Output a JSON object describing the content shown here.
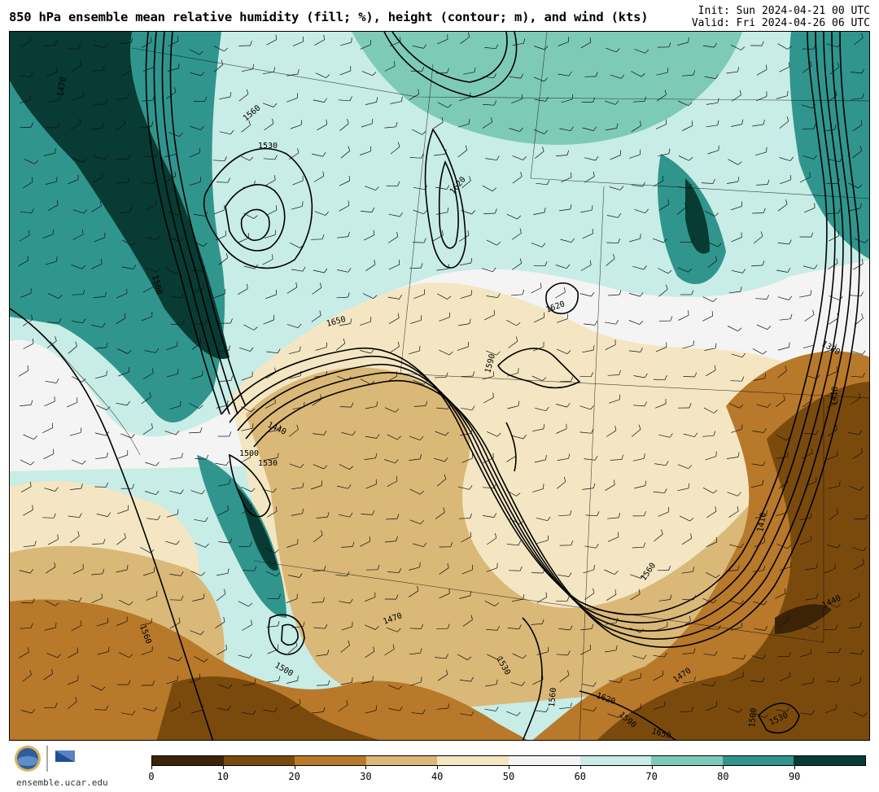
{
  "header": {
    "title": "850 hPa ensemble mean relative humidity (fill; %), height (contour; m), and wind (kts)",
    "init": "Init: Sun 2024-04-21 00 UTC",
    "valid": "Valid: Fri 2024-04-26 06 UTC"
  },
  "footer": {
    "site": "ensemble.ucar.edu",
    "logos": [
      "NSF",
      "NCAR"
    ]
  },
  "colorbar": {
    "ticks": [
      "0",
      "10",
      "20",
      "30",
      "40",
      "50",
      "60",
      "70",
      "80",
      "90"
    ],
    "colors": [
      "#3d2306",
      "#7a4a0d",
      "#b8792a",
      "#dab877",
      "#f4e6c2",
      "#f4f4f4",
      "#c8ece6",
      "#7ecab9",
      "#30958d",
      "#073b33"
    ]
  },
  "contour_labels": [
    "1470",
    "1500",
    "1530",
    "1560",
    "1650",
    "1620",
    "1590",
    "1440",
    "1380",
    "1410",
    "1500",
    "1530",
    "1560",
    "1470",
    "1500",
    "1530",
    "1560",
    "1590",
    "1620",
    "1650",
    "1410",
    "1440",
    "1470",
    "1500",
    "1530",
    "1560",
    "1620"
  ]
}
